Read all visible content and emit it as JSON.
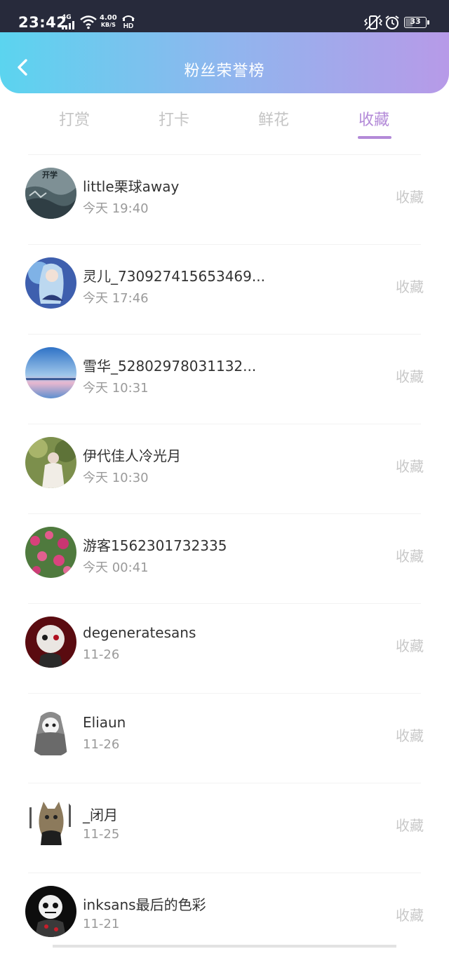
{
  "status_bar": {
    "time": "23:42",
    "network_type": "4G",
    "speed_value": "4.00",
    "speed_unit": "KB/S",
    "hd_label": "HD",
    "battery_level": "33"
  },
  "header": {
    "title": "粉丝荣誉榜"
  },
  "tabs": [
    {
      "label": "打赏",
      "active": false
    },
    {
      "label": "打卡",
      "active": false
    },
    {
      "label": "鲜花",
      "active": false
    },
    {
      "label": "收藏",
      "active": true
    }
  ],
  "fans": [
    {
      "name": "little栗球away",
      "time": "今天 19:40",
      "action": "收藏",
      "avatar_badge": "开学"
    },
    {
      "name": "灵儿_730927415653469...",
      "time": "今天 17:46",
      "action": "收藏"
    },
    {
      "name": "雪华_52802978031132...",
      "time": "今天 10:31",
      "action": "收藏"
    },
    {
      "name": "伊代佳人冷光月",
      "time": "今天 10:30",
      "action": "收藏"
    },
    {
      "name": "游客1562301732335",
      "time": "今天 00:41",
      "action": "收藏"
    },
    {
      "name": "degeneratesans",
      "time": "11-26",
      "action": "收藏"
    },
    {
      "name": "Eliaun",
      "time": "11-26",
      "action": "收藏"
    },
    {
      "name": "_闭月",
      "time": "11-25",
      "action": "收藏"
    },
    {
      "name": "inksans最后的色彩",
      "time": "11-21",
      "action": "收藏"
    }
  ],
  "colors": {
    "accent": "#b38ad8",
    "header_start": "#5bd4ef",
    "header_end": "#b79ae8",
    "inactive_tab": "#c4c4c4"
  },
  "icons": [
    "back-arrow-icon",
    "signal-icon",
    "wifi-icon",
    "hd-call-icon",
    "vibrate-icon",
    "alarm-icon",
    "battery-icon"
  ]
}
